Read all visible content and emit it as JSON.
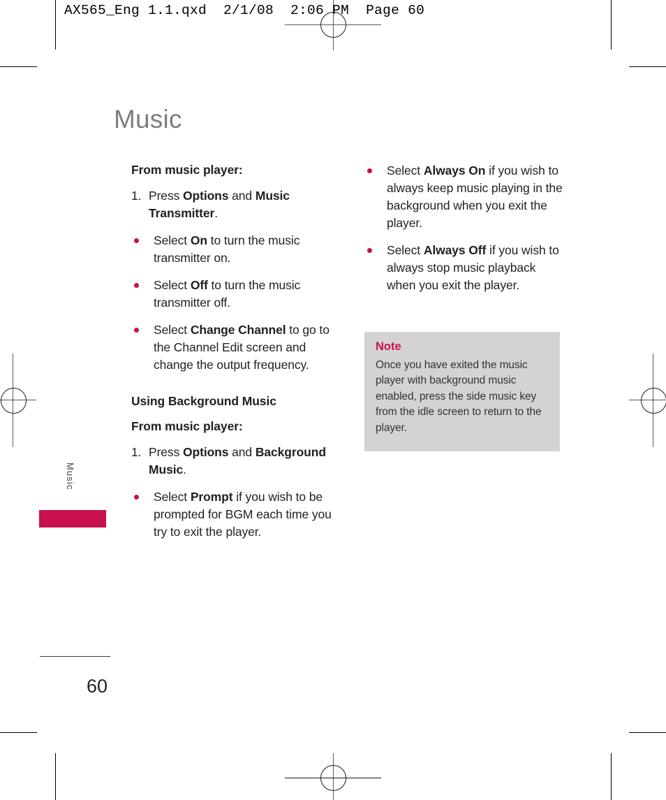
{
  "header": {
    "slug": "AX565_Eng 1.1.qxd  2/1/08  2:06 PM  Page 60"
  },
  "page": {
    "title": "Music",
    "folio": "60",
    "side_tab_label": "Music"
  },
  "colors": {
    "accent": "#c8104e",
    "title_gray": "#7d7d7d",
    "note_background": "#d3d3d3",
    "body_text": "#231f20"
  },
  "left_column": {
    "subhead_1": "From music player:",
    "step_1_num": "1.",
    "step_1_pre": "Press ",
    "step_1_bold_a": "Options",
    "step_1_mid": " and ",
    "step_1_bold_b": "Music Transmitter",
    "step_1_post": ".",
    "bullets": [
      {
        "pre": "Select ",
        "bold": "On",
        "post": " to turn the music transmitter on."
      },
      {
        "pre": "Select ",
        "bold": "Off",
        "post": " to turn the music transmitter off."
      },
      {
        "pre": "Select ",
        "bold": "Change Channel",
        "post": " to go to the Channel Edit screen and change the output frequency."
      }
    ],
    "subhead_2": "Using Background Music",
    "subhead_3": "From music player:",
    "step_2_num": "1.",
    "step_2_pre": "Press ",
    "step_2_bold_a": "Options",
    "step_2_mid": " and ",
    "step_2_bold_b": "Background Music",
    "step_2_post": ".",
    "bullet_prompt": {
      "pre": "Select ",
      "bold": "Prompt",
      "post": " if you wish to be prompted for BGM each time you try to exit the player."
    }
  },
  "right_column": {
    "bullets": [
      {
        "pre": "Select ",
        "bold": "Always On",
        "post": " if you wish to always keep music playing in the background when you exit the player."
      },
      {
        "pre": "Select ",
        "bold": "Always Off",
        "post": " if you wish to always stop music playback when you exit the player."
      }
    ],
    "note": {
      "title": "Note",
      "body": "Once you have exited the music player with background music enabled, press the side music key from the idle screen to return to the player."
    }
  }
}
